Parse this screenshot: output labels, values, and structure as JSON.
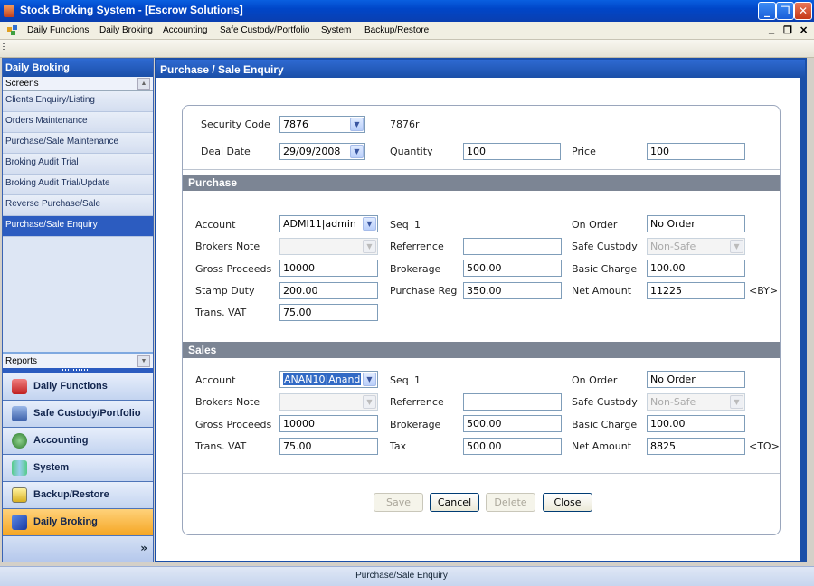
{
  "window": {
    "title": "Stock Broking System - [Escrow Solutions]",
    "minimize": "_",
    "restore": "❐",
    "close": "✕"
  },
  "menu": {
    "items": [
      "Daily Functions",
      "Daily Broking",
      "Accounting",
      "Safe Custody/Portfolio",
      "System",
      "Backup/Restore"
    ],
    "mdi_min": "_",
    "mdi_restore": "❐",
    "mdi_close": "✕"
  },
  "sidebar": {
    "header": "Daily Broking",
    "screens_label": "Screens",
    "items": [
      "Clients Enquiry/Listing",
      "Orders Maintenance",
      "Purchase/Sale Maintenance",
      "Broking Audit Trial",
      "Broking Audit Trial/Update",
      "Reverse Purchase/Sale",
      "Purchase/Sale Enquiry"
    ],
    "selected_index": 6,
    "reports_label": "Reports",
    "nav": [
      "Daily Functions",
      "Safe Custody/Portfolio",
      "Accounting",
      "System",
      "Backup/Restore",
      "Daily Broking"
    ],
    "nav_active_index": 5,
    "expand": "»"
  },
  "main": {
    "header": "Purchase / Sale Enquiry",
    "top": {
      "security_code_label": "Security Code",
      "security_code": "7876",
      "security_name": "7876r",
      "deal_date_label": "Deal Date",
      "deal_date": "29/09/2008",
      "quantity_label": "Quantity",
      "quantity": "100",
      "price_label": "Price",
      "price": "100"
    },
    "purchase": {
      "title": "Purchase",
      "account_label": "Account",
      "account": "ADMI11|admin",
      "seq_label": "Seq",
      "seq": "1",
      "on_order_label": "On Order",
      "on_order": "No Order",
      "brokers_note_label": "Brokers Note",
      "brokers_note": "",
      "referrence_label": "Referrence",
      "referrence": "",
      "safe_custody_label": "Safe Custody",
      "safe_custody": "Non-Safe",
      "gross_label": "Gross Proceeds",
      "gross": "10000",
      "brokerage_label": "Brokerage",
      "brokerage": "500.00",
      "basic_charge_label": "Basic Charge",
      "basic_charge": "100.00",
      "stamp_label": "Stamp Duty",
      "stamp": "200.00",
      "purchase_reg_label": "Purchase Reg",
      "purchase_reg": "350.00",
      "net_label": "Net Amount",
      "net": "11225",
      "net_suffix": "<BY>",
      "vat_label": "Trans. VAT",
      "vat": "75.00"
    },
    "sales": {
      "title": "Sales",
      "account_label": "Account",
      "account": "ANAN10|Anand",
      "seq_label": "Seq",
      "seq": "1",
      "on_order_label": "On Order",
      "on_order": "No Order",
      "brokers_note_label": "Brokers Note",
      "brokers_note": "",
      "referrence_label": "Referrence",
      "referrence": "",
      "safe_custody_label": "Safe Custody",
      "safe_custody": "Non-Safe",
      "gross_label": "Gross Proceeds",
      "gross": "10000",
      "brokerage_label": "Brokerage",
      "brokerage": "500.00",
      "basic_charge_label": "Basic Charge",
      "basic_charge": "100.00",
      "vat_label": "Trans. VAT",
      "vat": "75.00",
      "tax_label": "Tax",
      "tax": "500.00",
      "net_label": "Net Amount",
      "net": "8825",
      "net_suffix": "<TO>"
    },
    "buttons": {
      "save": "Save",
      "cancel": "Cancel",
      "delete": "Delete",
      "close": "Close"
    }
  },
  "status": {
    "text": "Purchase/Sale Enquiry"
  }
}
